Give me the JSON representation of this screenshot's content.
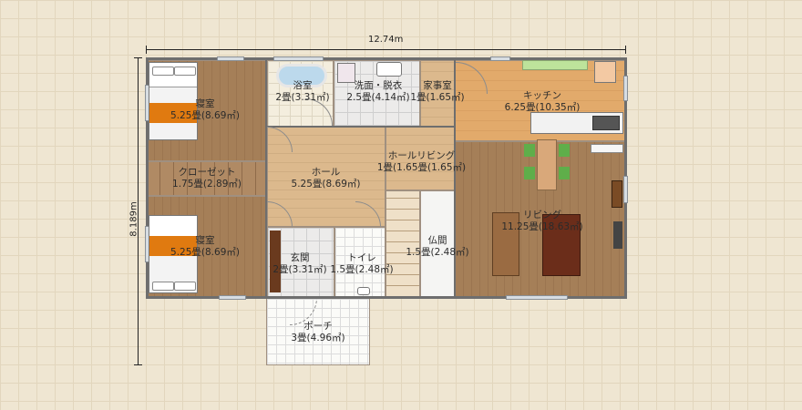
{
  "dimensions": {
    "width_label": "12.74m",
    "height_label": "8.189m"
  },
  "rooms": {
    "bedroom1": {
      "name": "寝室",
      "size": "5.25畳(8.69㎡)"
    },
    "closet": {
      "name": "クローゼット",
      "size": "1.75畳(2.89㎡)"
    },
    "bedroom2": {
      "name": "寝室",
      "size": "5.25畳(8.69㎡)"
    },
    "bath": {
      "name": "浴室",
      "size": "2畳(3.31㎡)"
    },
    "washroom": {
      "name": "洗面・脱衣",
      "size": "2.5畳(4.14㎡)"
    },
    "utility": {
      "name": "家事室",
      "size": "1畳(1.65㎡)"
    },
    "hall": {
      "name": "ホール",
      "size": "5.25畳(8.69㎡)"
    },
    "hall_living": {
      "name": "ホールリビング",
      "size": "1畳(1.65畳(1.65㎡)"
    },
    "entrance": {
      "name": "玄関",
      "size": "2畳(3.31㎡)"
    },
    "toilet": {
      "name": "トイレ",
      "size": "1.5畳(2.48㎡)"
    },
    "butsuma": {
      "name": "仏間",
      "size": "1.5畳(2.48㎡)"
    },
    "kitchen": {
      "name": "キッチン",
      "size": "6.25畳(10.35㎡)"
    },
    "living": {
      "name": "リビング",
      "size": "11.25畳(18.63㎡)"
    },
    "porch": {
      "name": "ポーチ",
      "size": "3畳(4.96㎡)"
    }
  },
  "colors": {
    "bedspread": "#e07a10",
    "kitchen_floor": "#e2aa6b",
    "living_floor": "#a57f58",
    "wall": "#6e6e6e"
  }
}
